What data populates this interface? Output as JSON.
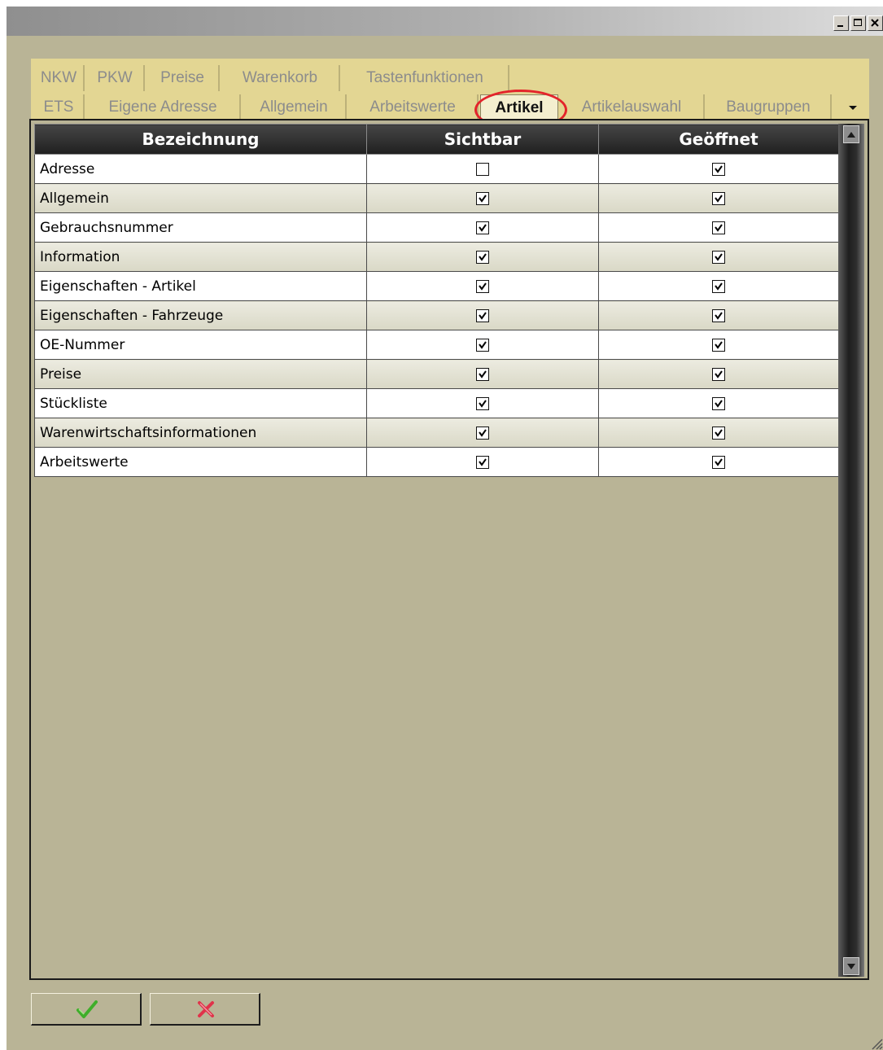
{
  "window": {
    "controls": [
      "minimize-icon",
      "maximize-icon",
      "close-icon"
    ]
  },
  "tabs": {
    "row1": [
      "NKW",
      "PKW",
      "Preise",
      "Warenkorb",
      "Tastenfunktionen"
    ],
    "row2": [
      "ETS",
      "Eigene Adresse",
      "Allgemein",
      "Arbeitswerte",
      "Artikel",
      "Artikelauswahl",
      "Baugruppen"
    ],
    "active": "Artikel",
    "highlight_color": "#e3242b"
  },
  "grid": {
    "columns": [
      "Bezeichnung",
      "Sichtbar",
      "Geöffnet"
    ],
    "rows": [
      {
        "name": "Adresse",
        "sichtbar": false,
        "geoeffnet": true
      },
      {
        "name": "Allgemein",
        "sichtbar": true,
        "geoeffnet": true
      },
      {
        "name": "Gebrauchsnummer",
        "sichtbar": true,
        "geoeffnet": true
      },
      {
        "name": "Information",
        "sichtbar": true,
        "geoeffnet": true
      },
      {
        "name": "Eigenschaften - Artikel",
        "sichtbar": true,
        "geoeffnet": true
      },
      {
        "name": "Eigenschaften - Fahrzeuge",
        "sichtbar": true,
        "geoeffnet": true
      },
      {
        "name": "OE-Nummer",
        "sichtbar": true,
        "geoeffnet": true
      },
      {
        "name": "Preise",
        "sichtbar": true,
        "geoeffnet": true
      },
      {
        "name": "Stückliste",
        "sichtbar": true,
        "geoeffnet": true
      },
      {
        "name": "Warenwirtschaftsinformationen",
        "sichtbar": true,
        "geoeffnet": true
      },
      {
        "name": "Arbeitswerte",
        "sichtbar": true,
        "geoeffnet": true
      }
    ]
  },
  "buttons": {
    "ok_icon": "green-checkmark-icon",
    "cancel_icon": "red-x-icon"
  },
  "colors": {
    "window_bg": "#b9b496",
    "tab_bg": "#e3d693",
    "header_bg": "#2a2a2a",
    "ok": "#3fae2a",
    "cancel": "#e0334a"
  }
}
